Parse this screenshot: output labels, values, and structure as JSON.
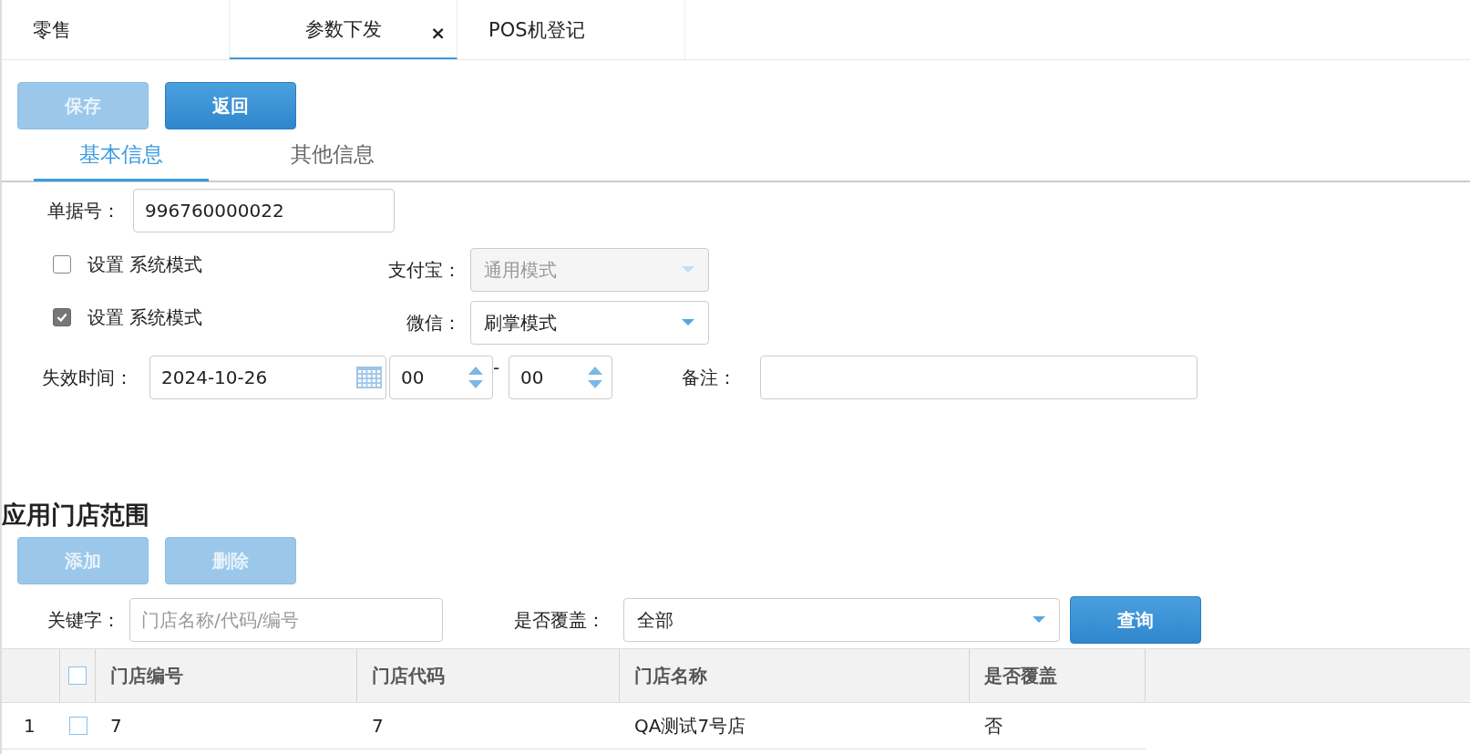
{
  "tabs": [
    {
      "label": "零售",
      "selected": false
    },
    {
      "label": "参数下发",
      "selected": true,
      "close": "×"
    },
    {
      "label": "POS机登记",
      "selected": false
    }
  ],
  "toolbar": [
    {
      "label": "保存",
      "disabled": true
    },
    {
      "label": "返回",
      "disabled": false
    }
  ],
  "subtabs": [
    {
      "label": "基本信息",
      "selected": true
    },
    {
      "label": "其他信息",
      "selected": false
    }
  ],
  "form": {
    "doc_no": {
      "label": "单据号：",
      "value": "996760000022"
    },
    "options": [
      {
        "label": "设置 系统模式",
        "checked": false,
        "select_label": "支付宝：",
        "select_value": "通用模式",
        "select_disabled": true
      },
      {
        "label": "设置 系统模式",
        "checked": true,
        "select_label": "微信：",
        "select_value": "刷掌模式",
        "select_disabled": false
      }
    ],
    "expiry": {
      "label": "失效时间：",
      "date": "2024-10-26",
      "hour": "00",
      "separator": "-",
      "minute": "00"
    },
    "remark": {
      "label": "备注："
    }
  },
  "section": {
    "title": "应用门店范围",
    "buttons": [
      {
        "label": "添加",
        "disabled": true
      },
      {
        "label": "删除",
        "disabled": true
      }
    ],
    "filter": {
      "keyword_label": "关键字：",
      "keyword_placeholder": "门店名称/代码/编号",
      "cover_label": "是否覆盖：",
      "cover_value": "全部",
      "query": "查询"
    }
  },
  "table": {
    "header_checked": false,
    "columns": [
      "门店编号",
      "门店代码",
      "门店名称",
      "是否覆盖"
    ],
    "rows": [
      {
        "index": "1",
        "checked": false,
        "cells": [
          "7",
          "7",
          "QA测试7号店",
          "否"
        ]
      }
    ]
  }
}
